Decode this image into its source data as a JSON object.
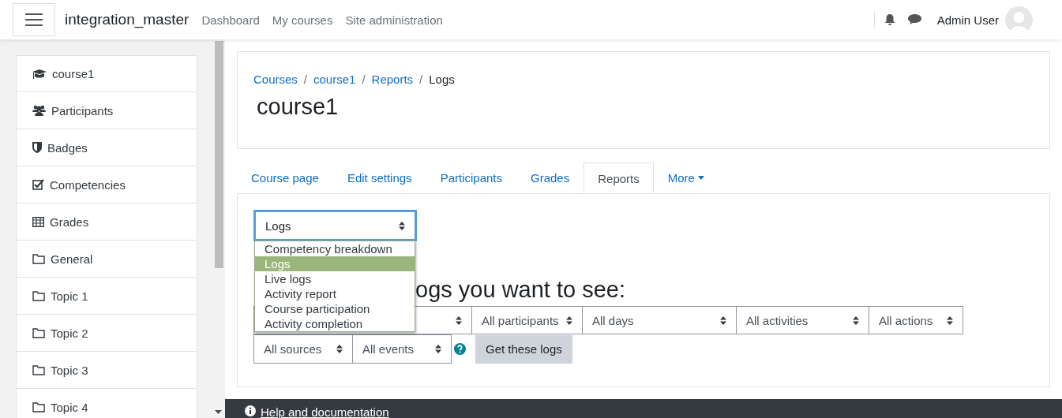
{
  "navbar": {
    "site_name": "integration_master",
    "links": [
      "Dashboard",
      "My courses",
      "Site administration"
    ],
    "user_name": "Admin User"
  },
  "sidebar": {
    "items": [
      {
        "label": "course1"
      },
      {
        "label": "Participants"
      },
      {
        "label": "Badges"
      },
      {
        "label": "Competencies"
      },
      {
        "label": "Grades"
      },
      {
        "label": "General"
      },
      {
        "label": "Topic 1"
      },
      {
        "label": "Topic 2"
      },
      {
        "label": "Topic 3"
      },
      {
        "label": "Topic 4"
      }
    ]
  },
  "breadcrumb": [
    {
      "label": "Courses",
      "link": true
    },
    {
      "separator": "/",
      "label": "course1",
      "link": true
    },
    {
      "separator": "/",
      "label": "Reports",
      "link": true
    },
    {
      "separator": "/",
      "label": "Logs",
      "link": false
    }
  ],
  "page_title": "course1",
  "tabs": [
    {
      "label": "Course page",
      "selected": false
    },
    {
      "label": "Edit settings",
      "selected": false
    },
    {
      "label": "Participants",
      "selected": false
    },
    {
      "label": "Grades",
      "selected": false
    },
    {
      "label": "Reports",
      "selected": true
    },
    {
      "label": "More",
      "selected": false,
      "caret": true
    }
  ],
  "report_select": {
    "value": "Logs",
    "options": [
      {
        "label": "Competency breakdown",
        "selected": false
      },
      {
        "label": "Logs",
        "selected": true
      },
      {
        "label": "Live logs",
        "selected": false
      },
      {
        "label": "Activity report",
        "selected": false
      },
      {
        "label": "Course participation",
        "selected": false
      },
      {
        "label": "Activity completion",
        "selected": false
      }
    ]
  },
  "heading": "ogs you want to see:",
  "filters_row1": [
    {
      "value": "All participants"
    },
    {
      "value": "All days"
    },
    {
      "value": "All activities"
    },
    {
      "value": "All actions"
    }
  ],
  "filters_row2": [
    {
      "value": "All sources"
    },
    {
      "value": "All events"
    }
  ],
  "submit_button": "Get these logs",
  "footer": {
    "link": "Help and documentation"
  }
}
